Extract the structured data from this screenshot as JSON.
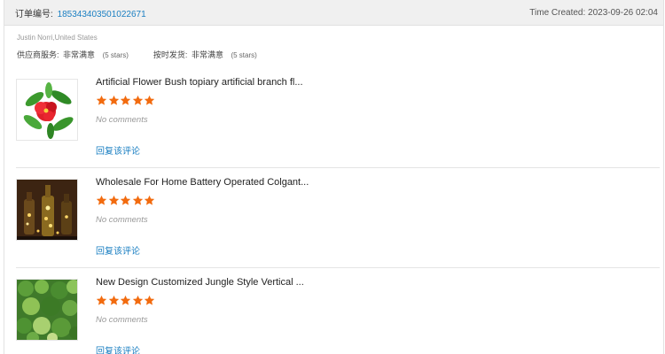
{
  "order": {
    "id_label": "订单编号:",
    "id_value": "185343403501022671",
    "time_created": "Time Created: 2023-09-26 02:04"
  },
  "buyer": {
    "name": "Justin Norri,United States",
    "supplier_service_label": "供应商服务:",
    "supplier_service_value": "非常满意",
    "supplier_service_stars": "(5 stars)",
    "on_time_label": "按时发货:",
    "on_time_value": "非常满意",
    "on_time_stars": "(5 stars)"
  },
  "products": [
    {
      "title": "Artificial Flower Bush topiary artificial branch fl...",
      "rating": 5,
      "comment": "No comments",
      "reply_label": "回复该评论",
      "thumb_icon": "red-flower-photo"
    },
    {
      "title": "Wholesale For Home Battery Operated Colgant...",
      "rating": 5,
      "comment": "No comments",
      "reply_label": "回复该评论",
      "thumb_icon": "fairy-light-bottle-photo"
    },
    {
      "title": "New Design Customized Jungle Style Vertical ...",
      "rating": 5,
      "comment": "No comments",
      "reply_label": "回复该评论",
      "thumb_icon": "green-wall-photo"
    }
  ],
  "colors": {
    "star": "#f26b0f",
    "link": "#1a7fc2",
    "header_bg": "#f0f0f0"
  }
}
